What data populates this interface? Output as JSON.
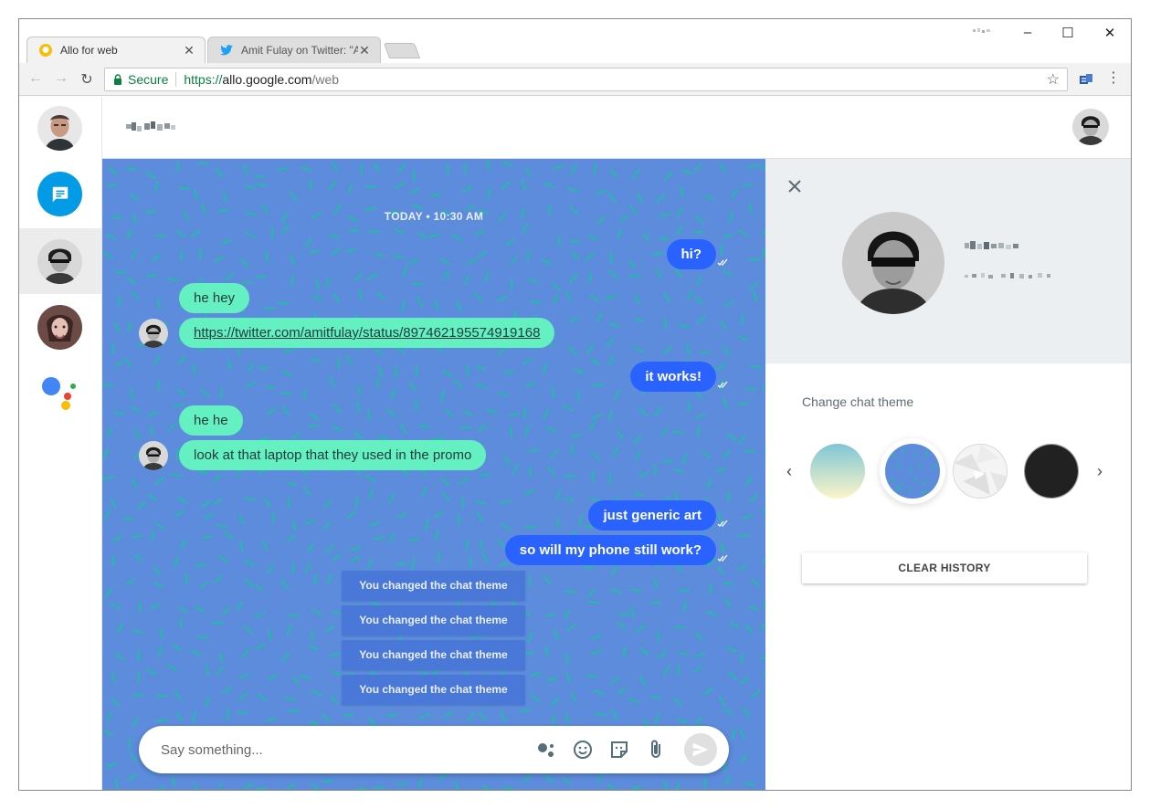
{
  "browser": {
    "tabs": [
      {
        "label": "Allo for web",
        "active": true
      },
      {
        "label": "Amit Fulay on Twitter: \"Al",
        "active": false
      }
    ],
    "address": {
      "secure_label": "Secure",
      "scheme": "https://",
      "host": "allo.google.com",
      "path": "/web"
    },
    "window_controls": {
      "minimize": "–",
      "maximize": "☐",
      "close": "✕"
    }
  },
  "chat": {
    "date_stamp": "TODAY • 10:30 AM",
    "messages": [
      {
        "dir": "out",
        "text": "hi?"
      },
      {
        "dir": "in",
        "text": "he hey"
      },
      {
        "dir": "in",
        "text": "https://twitter.com/amitfulay/status/897462195574919168",
        "link": true
      },
      {
        "dir": "out",
        "text": "it works!"
      },
      {
        "dir": "in",
        "text": "he he"
      },
      {
        "dir": "in",
        "text": "look at that laptop that they used in the promo"
      },
      {
        "dir": "out",
        "text": "just generic art"
      },
      {
        "dir": "out",
        "text": "so will my phone still work?"
      }
    ],
    "system_messages": [
      "You changed the chat theme",
      "You changed the chat theme",
      "You changed the chat theme",
      "You changed the chat theme"
    ],
    "compose_placeholder": "Say something...",
    "background_color": "#5d8cdd",
    "outgoing_color": "#2962ff",
    "incoming_color": "#64f0c0"
  },
  "panel": {
    "change_theme_label": "Change chat theme",
    "clear_history_label": "CLEAR HISTORY",
    "themes": [
      "gradient",
      "sprinkles",
      "geometric",
      "dark"
    ],
    "selected_theme": "sprinkles"
  },
  "icons": {
    "prev": "‹",
    "next": "›",
    "back": "←",
    "forward": "→",
    "reload": "↻",
    "star": "☆",
    "menu": "⋮",
    "tab_close": "✕"
  }
}
